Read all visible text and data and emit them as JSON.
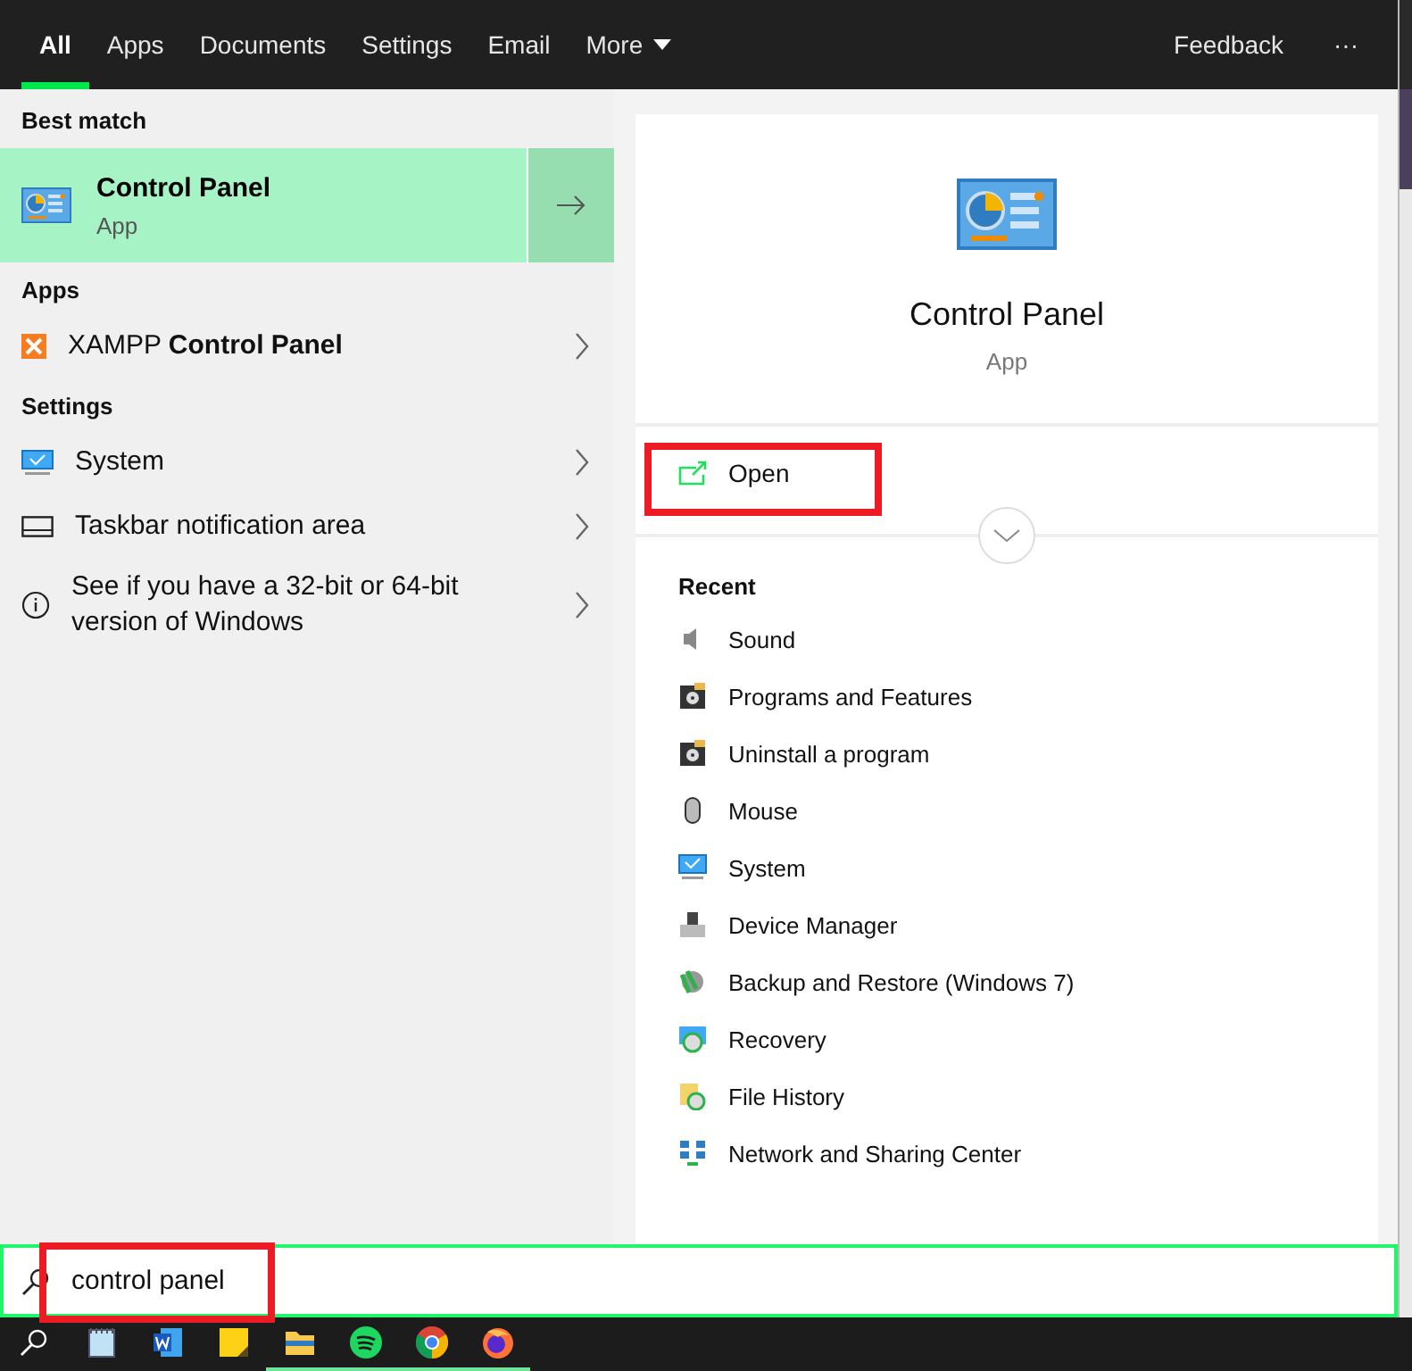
{
  "tabs": [
    {
      "label": "All",
      "selected": true,
      "kind": "tab"
    },
    {
      "label": "Apps",
      "selected": false,
      "kind": "tab"
    },
    {
      "label": "Documents",
      "selected": false,
      "kind": "tab"
    },
    {
      "label": "Settings",
      "selected": false,
      "kind": "tab"
    },
    {
      "label": "Email",
      "selected": false,
      "kind": "tab"
    },
    {
      "label": "More",
      "selected": false,
      "kind": "menu"
    }
  ],
  "feedback": "Feedback",
  "more_options": "···",
  "best_match": {
    "heading": "Best match",
    "title": "Control Panel",
    "subtitle": "App",
    "selected": true
  },
  "groups": [
    {
      "heading": "Apps",
      "items": [
        {
          "label": "XAMPP **Control Panel**"
        }
      ]
    },
    {
      "heading": "Settings",
      "items": [
        {
          "label": "System"
        },
        {
          "label": "Taskbar notification area"
        },
        {
          "label": "See if you have a 32-bit or 64-bit version of Windows"
        }
      ]
    }
  ],
  "detail": {
    "title": "Control Panel",
    "subtitle": "App",
    "action": "Open",
    "recent_heading": "Recent",
    "recent": [
      {
        "label": "Sound"
      },
      {
        "label": "Programs and Features"
      },
      {
        "label": "Uninstall a program"
      },
      {
        "label": "Mouse"
      },
      {
        "label": "System"
      },
      {
        "label": "Device Manager"
      },
      {
        "label": "Backup and Restore (Windows 7)"
      },
      {
        "label": "Recovery"
      },
      {
        "label": "File History"
      },
      {
        "label": "Network and Sharing Center"
      }
    ]
  },
  "search": {
    "value": "control panel"
  },
  "taskbar": {
    "apps": [
      {
        "running": false
      },
      {
        "running": false
      },
      {
        "running": false
      },
      {
        "running": true
      },
      {
        "running": true
      },
      {
        "running": true
      },
      {
        "running": true
      }
    ]
  }
}
